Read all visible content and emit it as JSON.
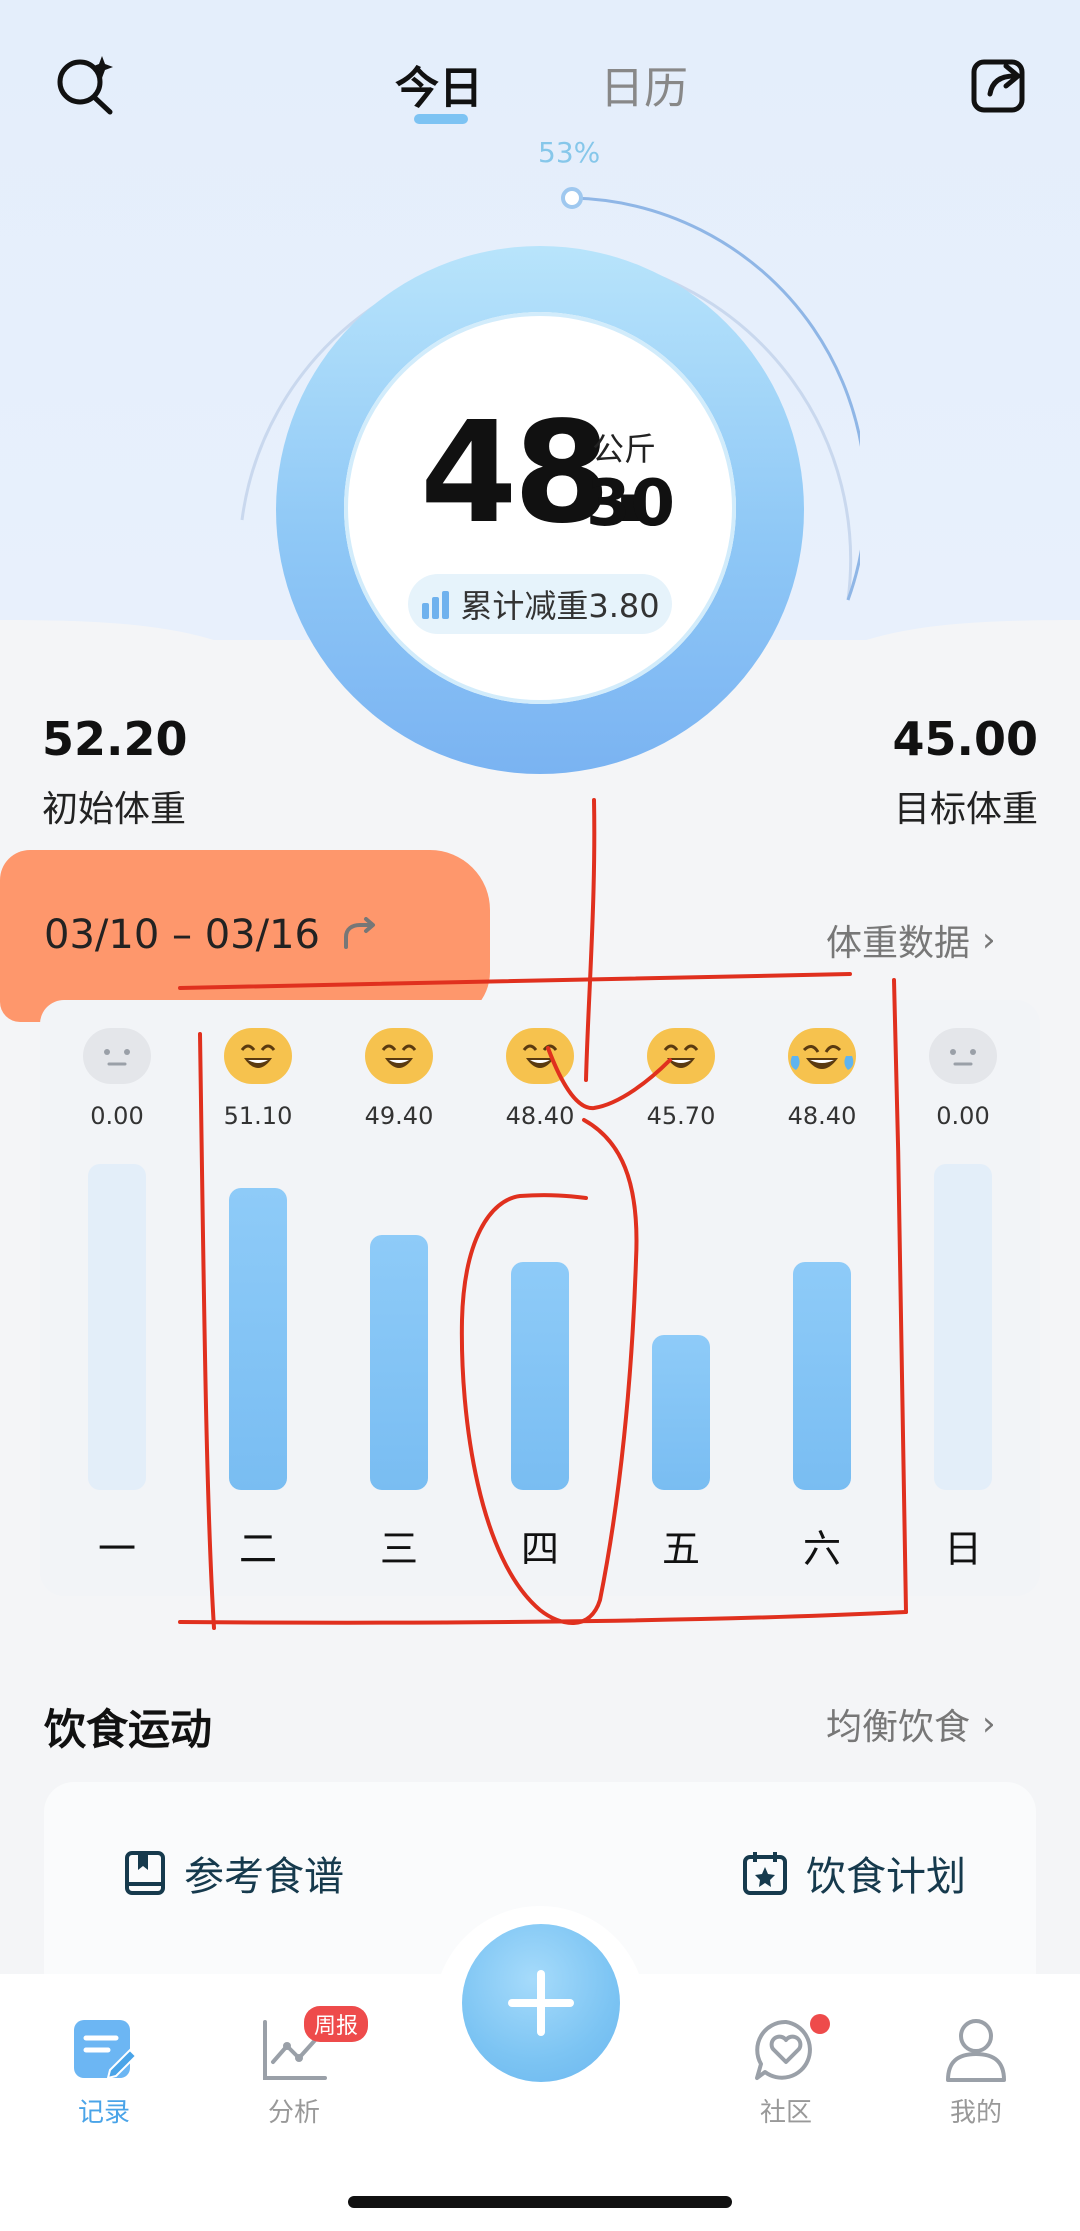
{
  "header": {
    "tabs": [
      {
        "label": "今日",
        "active": true
      },
      {
        "label": "日历",
        "active": false
      }
    ],
    "icons": {
      "left": "search-sparkle-icon",
      "right": "share-icon"
    }
  },
  "progress": {
    "percent_label": "53%",
    "percent": 53
  },
  "weight": {
    "integer": "48.",
    "decimal": "30",
    "unit": "公斤",
    "lost_label": "累计减重3.80"
  },
  "stats": {
    "initial": {
      "value": "52.20",
      "label": "初始体重"
    },
    "target": {
      "value": "45.00",
      "label": "目标体重"
    }
  },
  "week": {
    "range": "03/10 – 03/16",
    "data_link": "体重数据",
    "days": [
      {
        "label": "一",
        "value": "0.00",
        "mood": "neutral"
      },
      {
        "label": "二",
        "value": "51.10",
        "mood": "happy"
      },
      {
        "label": "三",
        "value": "49.40",
        "mood": "happy"
      },
      {
        "label": "四",
        "value": "48.40",
        "mood": "happy"
      },
      {
        "label": "五",
        "value": "45.70",
        "mood": "happy"
      },
      {
        "label": "六",
        "value": "48.40",
        "mood": "laughing"
      },
      {
        "label": "日",
        "value": "0.00",
        "mood": "neutral"
      }
    ]
  },
  "chart_data": {
    "type": "bar",
    "categories": [
      "一",
      "二",
      "三",
      "四",
      "五",
      "六",
      "日"
    ],
    "values": [
      0.0,
      51.1,
      49.4,
      48.4,
      45.7,
      48.4,
      0.0
    ]
  },
  "diet": {
    "title": "饮食运动",
    "link": "均衡饮食",
    "items": [
      {
        "label": "参考食谱",
        "icon": "recipe-book-icon"
      },
      {
        "label": "饮食计划",
        "icon": "calendar-star-icon"
      }
    ]
  },
  "nav": {
    "items": [
      {
        "label": "记录",
        "icon": "record-icon",
        "active": true
      },
      {
        "label": "分析",
        "icon": "analysis-chart-icon",
        "badge": "周报"
      },
      {
        "label": "社区",
        "icon": "community-heart-icon"
      },
      {
        "label": "我的",
        "icon": "profile-icon"
      }
    ],
    "add_icon": "plus-icon"
  },
  "colors": {
    "accent": "#7cc4f3",
    "annotation": "#e0301e",
    "highlight": "#ff8d5c"
  }
}
